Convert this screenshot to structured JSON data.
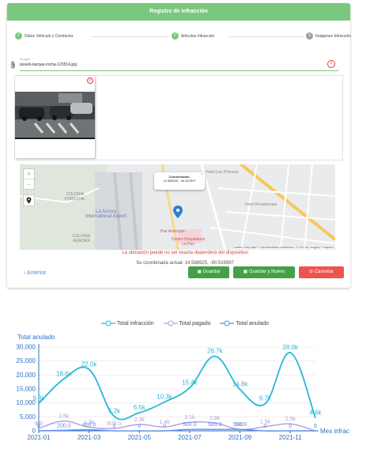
{
  "header": {
    "title": "Registro de Infracción"
  },
  "steps": [
    {
      "label": "Datos Vehiculo y Conductor",
      "mark": "✓"
    },
    {
      "label": "Articulos Infracción",
      "mark": "✓"
    },
    {
      "label": "Imágenes Infracción",
      "mark": "3"
    }
  ],
  "upload": {
    "label": "Imagen",
    "filename": "pexels-karque-rocha-123514.jpg"
  },
  "map": {
    "popup_title": "Coordenadas:",
    "popup_coords": "14.588925, -90.519997",
    "attribution": "Leaflet | Map data © OpenStreetMap contributors, CC-BY-SA, Imagery © Mapbox",
    "labels": {
      "colonia_forestal": "COLONIA FORESTAL",
      "la_aurora": "La Aurora International Airport",
      "colonia_aurora": "COLONIA AURORA",
      "hotel_princess": "Hotel Las Princess",
      "hotel_residencias": "Hotel Residencias",
      "centro_hospitalario": "Centro Hospitalario La Paz",
      "paz_americas": "Paz Américas"
    }
  },
  "messages": {
    "warning": "La ubicación puede no ser exacta dependerá del dispositivo",
    "current_coords": "Su coordenada actual: 14.588925, -90.519997"
  },
  "buttons": {
    "previous": "Anterior",
    "save": "Guardar",
    "save_new": "Guardar y Nuevo",
    "cancel": "Cancelar"
  },
  "colors": {
    "accent_green": "#7ac77e",
    "save_green": "#43a047",
    "cancel_red": "#ef5350",
    "link_blue": "#4a8fd8",
    "series_infraccion": "#29b6d6",
    "series_pagado": "#b39ddb",
    "series_anulado": "#5c8ee8"
  },
  "chart_data": {
    "type": "line",
    "ylabel": "Total anulado",
    "xlabel": "Mes infrac",
    "ylim": [
      0,
      30000
    ],
    "yticks": [
      "0",
      "5,000",
      "10,000",
      "15,000",
      "20,000",
      "25,000",
      "30,000"
    ],
    "x_tick_labels": [
      "2021-01",
      "2021-03",
      "2021-05",
      "2021-07",
      "2021-09",
      "2021-11"
    ],
    "categories": [
      "2021-01",
      "2021-02",
      "2021-03",
      "2021-04",
      "2021-05",
      "2021-06",
      "2021-07",
      "2021-08",
      "2021-09",
      "2021-10",
      "2021-11",
      "2021-12"
    ],
    "legend_position": "top",
    "series": [
      {
        "name": "Total infracción",
        "values": [
          9800,
          18600,
          22000,
          5200,
          6500,
          10300,
          15400,
          26700,
          14800,
          9700,
          28000,
          4600
        ],
        "labels": [
          "9.8k",
          "18.6k",
          "22.0k",
          "5.2k",
          "6.5k",
          "10.3k",
          "15.4k",
          "26.7k",
          "14.8k",
          "9.7k",
          "28.0k",
          "4.6k"
        ]
      },
      {
        "name": "Total pagado",
        "values": [
          900,
          3500,
          1300,
          876,
          2300,
          1400,
          3100,
          2800,
          500,
          1500,
          2500,
          0
        ],
        "labels": [
          "900",
          "3.5k",
          "1.3k",
          "876.0",
          "2.3k",
          "1.4k",
          "3.1k",
          "2.8k",
          "500",
          "1.5k",
          "2.5k",
          "0"
        ]
      },
      {
        "name": "Total anulado",
        "values": [
          0,
          200,
          400,
          0,
          0,
          0,
          500,
          500,
          500,
          0,
          0,
          0
        ],
        "labels": [
          "0",
          "200.0",
          "400.0",
          "0",
          "0",
          "0",
          "500.0",
          "500.0",
          "500.0",
          "0",
          "0",
          "0"
        ]
      }
    ]
  }
}
